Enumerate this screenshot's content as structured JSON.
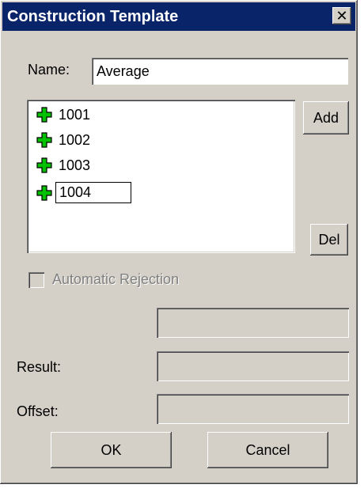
{
  "window": {
    "title": "Construction Template",
    "close_label": "✕"
  },
  "name": {
    "label": "Name:",
    "value": "Average"
  },
  "list": {
    "items": [
      {
        "label": "1001"
      },
      {
        "label": "1002"
      },
      {
        "label": "1003"
      },
      {
        "label": "1004"
      }
    ]
  },
  "buttons": {
    "add": "Add",
    "del": "Del",
    "ok": "OK",
    "cancel": "Cancel"
  },
  "rejection": {
    "label": "Automatic Rejection",
    "checked": false
  },
  "fields": {
    "result_label": "Result:",
    "offset_label": "Offset:"
  },
  "colors": {
    "titlebar": "#0a246a",
    "face": "#d4d0c8",
    "plus_icon": "#00c000"
  }
}
